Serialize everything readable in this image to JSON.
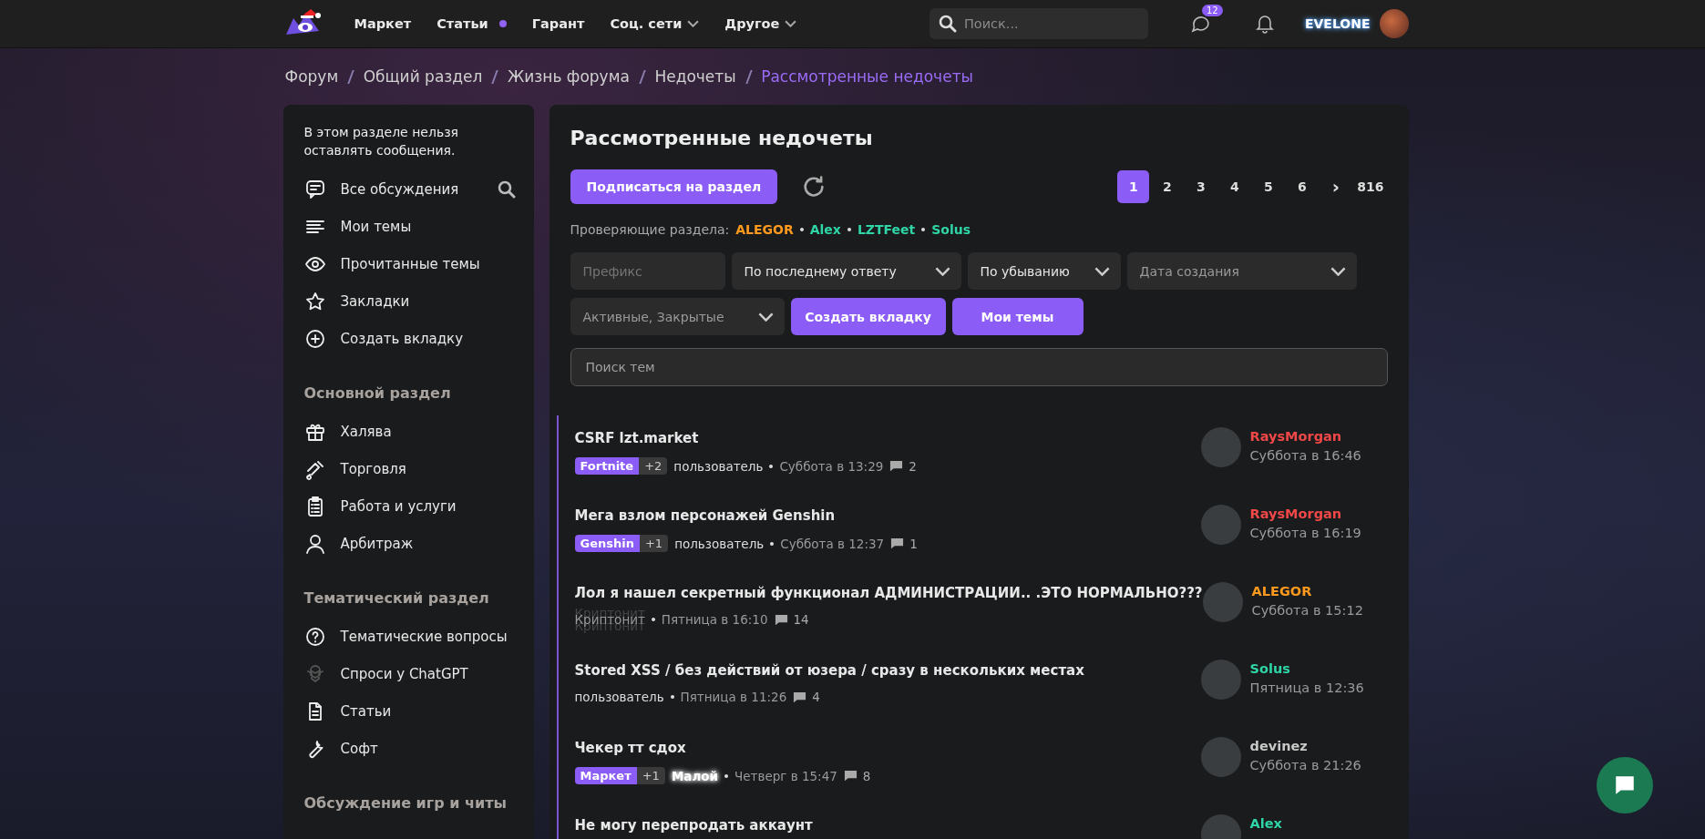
{
  "header": {
    "nav": [
      {
        "label": "Маркет",
        "notification": false,
        "dropdown": false
      },
      {
        "label": "Статьи",
        "notification": true,
        "dropdown": false
      },
      {
        "label": "Гарант",
        "notification": false,
        "dropdown": false
      },
      {
        "label": "Соц. сети",
        "notification": false,
        "dropdown": true
      },
      {
        "label": "Другое",
        "notification": false,
        "dropdown": true
      }
    ],
    "search_placeholder": "Поиск...",
    "messages_badge": "12",
    "username": "EVELONE"
  },
  "breadcrumbs": [
    {
      "label": "Форум",
      "current": false
    },
    {
      "label": "Общий раздел",
      "current": false
    },
    {
      "label": "Жизнь форума",
      "current": false
    },
    {
      "label": "Недочеты",
      "current": false
    },
    {
      "label": "Рассмотренные недочеты",
      "current": true
    }
  ],
  "sidebar": {
    "notice": "В этом разделе нельзя оставлять сообщения.",
    "items": [
      "Все обсуждения",
      "Мои темы",
      "Прочитанные темы",
      "Закладки",
      "Создать вкладку"
    ],
    "sections": [
      {
        "title": "Основной раздел",
        "items": [
          "Халява",
          "Торговля",
          "Работа и услуги",
          "Арбитраж"
        ]
      },
      {
        "title": "Тематический раздел",
        "items": [
          "Тематические вопросы",
          "Спроси у ChatGPT",
          "Статьи",
          "Софт"
        ]
      },
      {
        "title": "Обсуждение игр и читы"
      }
    ]
  },
  "main": {
    "title": "Рассмотренные недочеты",
    "subscribe_button": "Подписаться на раздел",
    "pages": [
      {
        "label": "1",
        "selected": true
      },
      {
        "label": "2",
        "selected": false
      },
      {
        "label": "3",
        "selected": false
      },
      {
        "label": "4",
        "selected": false
      },
      {
        "label": "5",
        "selected": false
      },
      {
        "label": "6",
        "selected": false
      }
    ],
    "next_page": "›",
    "last_page": "816",
    "reviewers_label": "Проверяющие раздела:",
    "reviewers": [
      {
        "name": "ALEGOR",
        "color": "#ff9a1f"
      },
      {
        "name": "Alex",
        "color": "#2fd5a7"
      },
      {
        "name": "LZTFeet",
        "color": "#2fd5a7"
      },
      {
        "name": "Solus",
        "color": "#2fd5a7"
      }
    ],
    "filters": [
      {
        "kind": "field",
        "placeholder": "Префикс"
      },
      {
        "kind": "select",
        "value": "По последнему ответу"
      },
      {
        "kind": "select",
        "value": "По убыванию"
      },
      {
        "kind": "select",
        "placeholder": "Дата создания"
      },
      {
        "kind": "select",
        "placeholder": "Активные, Закрытые"
      },
      {
        "kind": "button",
        "label": "Создать вкладку"
      },
      {
        "kind": "button",
        "label": "Мои темы"
      }
    ],
    "search_placeholder": "Поиск тем",
    "threads": [
      {
        "title": "CSRF lzt.market",
        "prefix": "Fortnite",
        "more_prefixes": "+2",
        "author": {
          "name": "пользователь",
          "kind": "plain"
        },
        "date": "Суббота в 13:29",
        "replies": "2",
        "last_user": {
          "name": "RaysMorgan",
          "color": "#f04848"
        },
        "last_date": "Суббота в 16:46"
      },
      {
        "title": "Мега взлом персонажей Genshin",
        "prefix": "Genshin",
        "more_prefixes": "+1",
        "author": {
          "name": "пользователь",
          "kind": "plain"
        },
        "date": "Суббота в 12:37",
        "replies": "1",
        "last_user": {
          "name": "RaysMorgan",
          "color": "#f04848"
        },
        "last_date": "Суббота в 16:19"
      },
      {
        "title": "Лол я нашел секретный функционал АДМИНИСТРАЦИИ.. .ЭТО НОРМАЛЬНО???",
        "author": {
          "name": "Криптонит",
          "kind": "shadowed"
        },
        "date": "Пятница в 16:10",
        "replies": "14",
        "last_user": {
          "name": "ALEGOR",
          "color": "#ff9a1f"
        },
        "last_date": "Суббота в 15:12"
      },
      {
        "title": "Stored XSS / без действий от юзера / сразу в нескольких местах",
        "author": {
          "name": "пользователь",
          "kind": "plain"
        },
        "date": "Пятница в 11:26",
        "replies": "4",
        "last_user": {
          "name": "Solus",
          "color": "#2fd5a7"
        },
        "last_date": "Пятница в 12:36"
      },
      {
        "title": "Чекер тт сдох",
        "prefix": "Маркет",
        "more_prefixes": "+1",
        "author": {
          "name": "Малой",
          "kind": "glow"
        },
        "date": "Четверг в 15:47",
        "replies": "8",
        "last_user": {
          "name": "devinez",
          "color": "#c8c8c8"
        },
        "last_date": "Суббота в 21:26"
      },
      {
        "title": "Не могу перепродать аккаунт",
        "last_user": {
          "name": "Alex",
          "color": "#2fd5a7"
        }
      }
    ]
  }
}
